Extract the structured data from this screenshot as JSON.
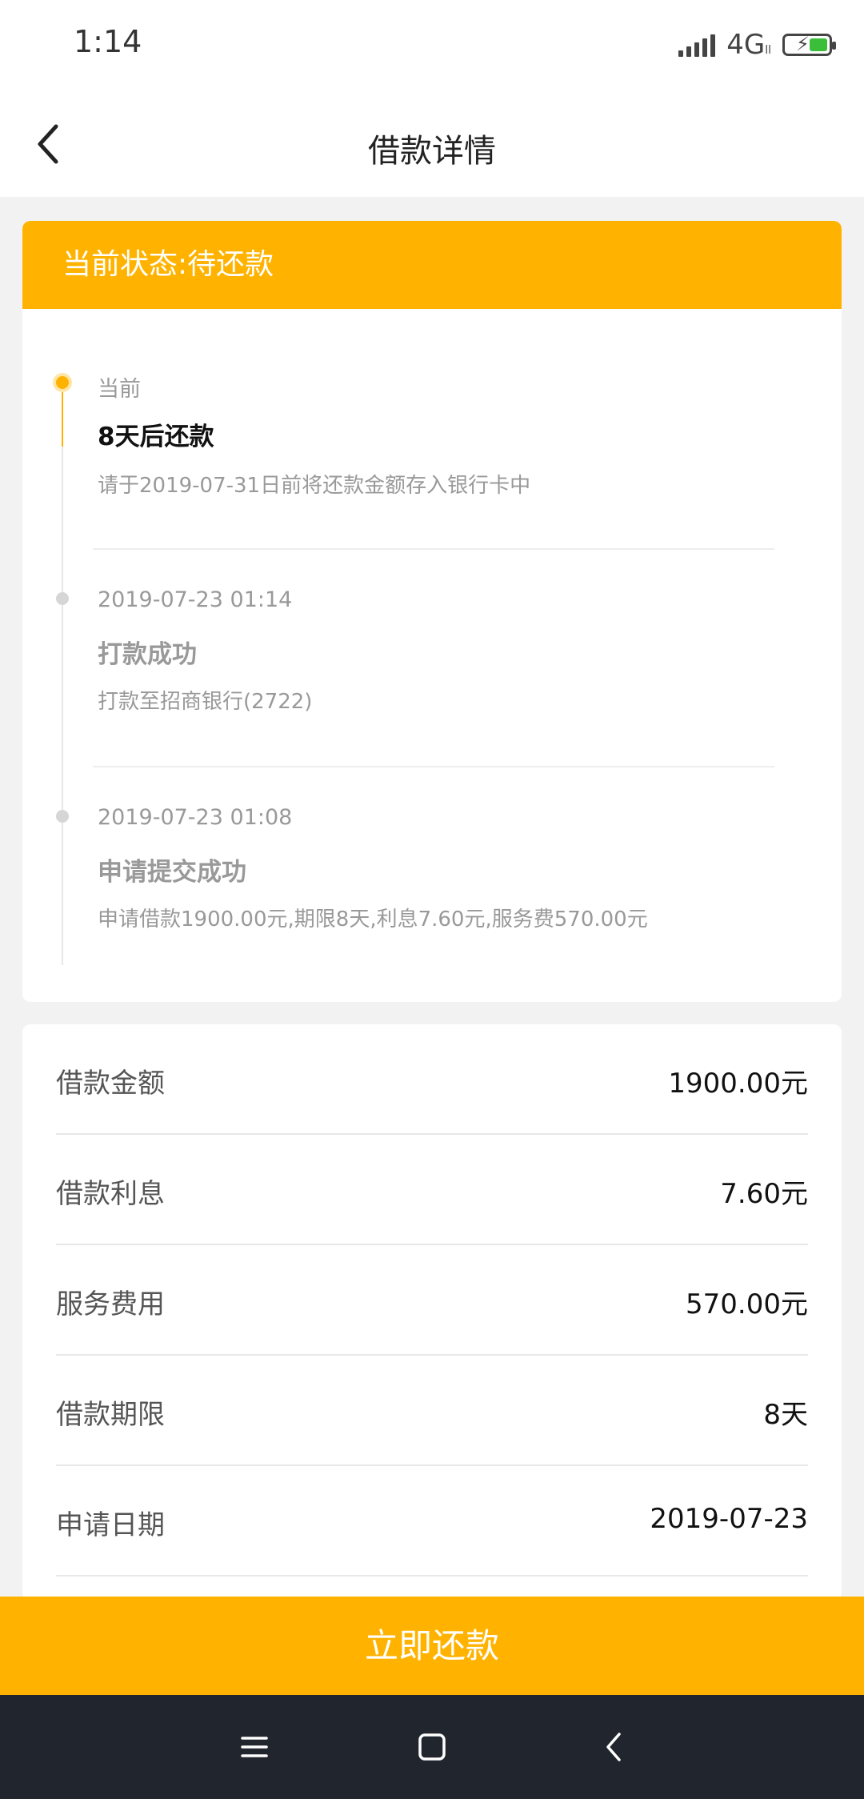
{
  "status_bar": {
    "time": "1:14",
    "network": "4G",
    "network_sub": "ll"
  },
  "header": {
    "title": "借款详情"
  },
  "status_card": {
    "banner": "当前状态:待还款",
    "timeline": [
      {
        "time": "当前",
        "title": "8天后还款",
        "desc": "请于2019-07-31日前将还款金额存入银行卡中",
        "active": true
      },
      {
        "time": "2019-07-23 01:14",
        "title": "打款成功",
        "desc": "打款至招商银行(2722)",
        "active": false
      },
      {
        "time": "2019-07-23 01:08",
        "title": "申请提交成功",
        "desc": "申请借款1900.00元,期限8天,利息7.60元,服务费570.00元",
        "active": false
      }
    ]
  },
  "details": [
    {
      "label": "借款金额",
      "value": "1900.00元"
    },
    {
      "label": "借款利息",
      "value": "7.60元"
    },
    {
      "label": "服务费用",
      "value": "570.00元"
    },
    {
      "label": "借款期限",
      "value": "8天"
    },
    {
      "label": "申请日期",
      "value": "2019-07-23"
    }
  ],
  "repay_button": {
    "label": "立即还款"
  },
  "colors": {
    "accent": "#ffb300",
    "nav_bg": "#21252e"
  },
  "icons": {
    "back": "chevron-left-icon",
    "nav_menu": "menu-icon",
    "nav_home": "square-home-icon",
    "nav_back": "back-triangle-icon"
  }
}
